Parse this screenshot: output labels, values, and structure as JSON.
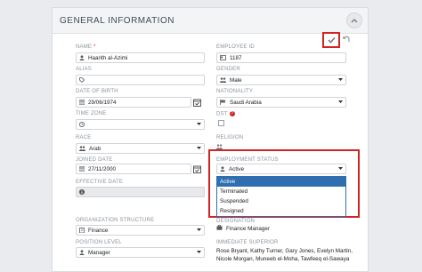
{
  "panel": {
    "title": "GENERAL INFORMATION"
  },
  "fields": {
    "name": {
      "label": "NAME",
      "required": "*",
      "value": "Haarith al-Azimi"
    },
    "employee_id": {
      "label": "EMPLOYEE ID",
      "value": "1187"
    },
    "alias": {
      "label": "ALIAS",
      "value": ""
    },
    "gender": {
      "label": "GENDER",
      "value": "Male"
    },
    "dob": {
      "label": "DATE OF BIRTH",
      "value": "29/06/1974"
    },
    "nationality": {
      "label": "NATIONALITY",
      "value": "Saudi Arabia"
    },
    "time_zone": {
      "label": "TIME ZONE",
      "value": ""
    },
    "dst": {
      "label": "DST",
      "help": "?"
    },
    "race": {
      "label": "RACE",
      "value": "Arab"
    },
    "religion": {
      "label": "RELIGION",
      "value": ""
    },
    "joined_date": {
      "label": "JOINED DATE",
      "value": "27/11/2000"
    },
    "employment_status": {
      "label": "EMPLOYMENT STATUS",
      "value": "Active",
      "options": [
        "Active",
        "Terminated",
        "Suspended",
        "Resigned"
      ]
    },
    "effective_date": {
      "label": "EFFECTIVE DATE",
      "value": ""
    },
    "org_structure": {
      "label": "ORGANIZATION STRUCTURE",
      "value": "Finance"
    },
    "designation": {
      "label": "DESIGNATION",
      "value": "Finance Manager"
    },
    "position_level": {
      "label": "POSITION LEVEL",
      "value": "Manager"
    },
    "immediate_superior": {
      "label": "IMMEDIATE SUPERIOR",
      "value": "Rose Bryant, Kathy Turner, Gary Jones, Evelyn Martin, Nicole Morgan, Muneeb el-Moha, Tawfeeq el-Sawaya"
    }
  },
  "icons": {
    "save": "check-icon",
    "undo": "undo-icon",
    "collapse": "chevron-up-icon"
  },
  "colors": {
    "highlight": "#d12424",
    "selected": "#2f6fb0"
  }
}
